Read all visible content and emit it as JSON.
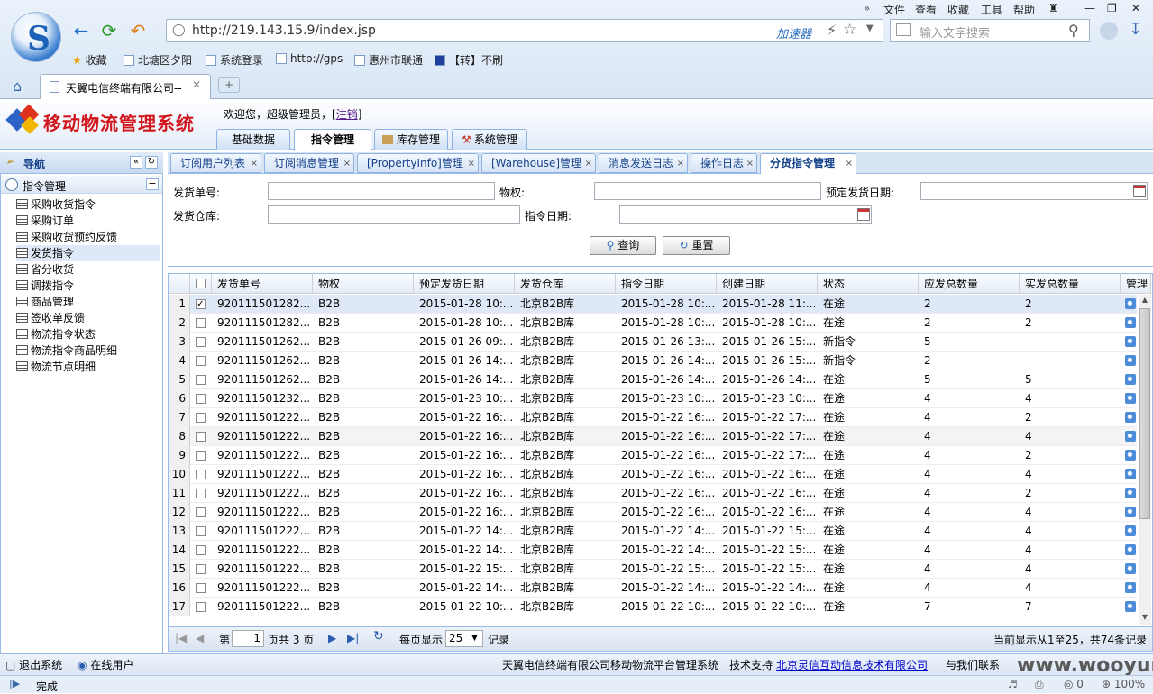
{
  "browser": {
    "menu": [
      "文件",
      "查看",
      "收藏",
      "工具",
      "帮助"
    ],
    "url": "http://219.143.15.9/index.jsp",
    "accelerator": "加速器",
    "search_placeholder": "输入文字搜索",
    "bookmarks": [
      "收藏",
      "北塘区夕阳",
      "系统登录",
      "http://gps",
      "惠州市联通",
      "【转】不刷"
    ],
    "tab_title": "天翼电信终端有限公司--",
    "status": "完成",
    "zoom": "100%",
    "watermark": "www.wooyun.org"
  },
  "app": {
    "title": "移动物流管理系统",
    "welcome": "欢迎您，超级管理员，[",
    "logout": "注销",
    "welcome_end": "]",
    "main_tabs": [
      "基础数据",
      "指令管理",
      "库存管理",
      "系统管理"
    ]
  },
  "nav": {
    "title": "导航",
    "group": "指令管理",
    "items": [
      "采购收货指令",
      "采购订单",
      "采购收货预约反馈",
      "发货指令",
      "省分收货",
      "调拨指令",
      "商品管理",
      "签收单反馈",
      "物流指令状态",
      "物流指令商品明细",
      "物流节点明细"
    ]
  },
  "content_tabs": [
    "订阅用户列表",
    "订阅消息管理",
    "[PropertyInfo]管理",
    "[Warehouse]管理",
    "消息发送日志",
    "操作日志",
    "分货指令管理"
  ],
  "form": {
    "order_no": "发货单号:",
    "property": "物权:",
    "plan_date": "预定发货日期:",
    "warehouse": "发货仓库:",
    "cmd_date": "指令日期:",
    "query": "查询",
    "reset": "重置"
  },
  "grid": {
    "columns": [
      "发货单号",
      "物权",
      "预定发货日期",
      "发货仓库",
      "指令日期",
      "创建日期",
      "状态",
      "应发总数量",
      "实发总数量",
      "管理"
    ],
    "rows": [
      [
        "1",
        "920111501282...",
        "B2B",
        "2015-01-28 10:...",
        "北京B2B库",
        "2015-01-28 10:...",
        "2015-01-28 11:...",
        "在途",
        "2",
        "2"
      ],
      [
        "2",
        "920111501282...",
        "B2B",
        "2015-01-28 10:...",
        "北京B2B库",
        "2015-01-28 10:...",
        "2015-01-28 10:...",
        "在途",
        "2",
        "2"
      ],
      [
        "3",
        "920111501262...",
        "B2B",
        "2015-01-26 09:...",
        "北京B2B库",
        "2015-01-26 13:...",
        "2015-01-26 15:...",
        "新指令",
        "5",
        ""
      ],
      [
        "4",
        "920111501262...",
        "B2B",
        "2015-01-26 14:...",
        "北京B2B库",
        "2015-01-26 14:...",
        "2015-01-26 15:...",
        "新指令",
        "2",
        ""
      ],
      [
        "5",
        "920111501262...",
        "B2B",
        "2015-01-26 14:...",
        "北京B2B库",
        "2015-01-26 14:...",
        "2015-01-26 14:...",
        "在途",
        "5",
        "5"
      ],
      [
        "6",
        "920111501232...",
        "B2B",
        "2015-01-23 10:...",
        "北京B2B库",
        "2015-01-23 10:...",
        "2015-01-23 10:...",
        "在途",
        "4",
        "4"
      ],
      [
        "7",
        "920111501222...",
        "B2B",
        "2015-01-22 16:...",
        "北京B2B库",
        "2015-01-22 16:...",
        "2015-01-22 17:...",
        "在途",
        "4",
        "2"
      ],
      [
        "8",
        "920111501222...",
        "B2B",
        "2015-01-22 16:...",
        "北京B2B库",
        "2015-01-22 16:...",
        "2015-01-22 17:...",
        "在途",
        "4",
        "4"
      ],
      [
        "9",
        "920111501222...",
        "B2B",
        "2015-01-22 16:...",
        "北京B2B库",
        "2015-01-22 16:...",
        "2015-01-22 17:...",
        "在途",
        "4",
        "2"
      ],
      [
        "10",
        "920111501222...",
        "B2B",
        "2015-01-22 16:...",
        "北京B2B库",
        "2015-01-22 16:...",
        "2015-01-22 16:...",
        "在途",
        "4",
        "4"
      ],
      [
        "11",
        "920111501222...",
        "B2B",
        "2015-01-22 16:...",
        "北京B2B库",
        "2015-01-22 16:...",
        "2015-01-22 16:...",
        "在途",
        "4",
        "2"
      ],
      [
        "12",
        "920111501222...",
        "B2B",
        "2015-01-22 16:...",
        "北京B2B库",
        "2015-01-22 16:...",
        "2015-01-22 16:...",
        "在途",
        "4",
        "4"
      ],
      [
        "13",
        "920111501222...",
        "B2B",
        "2015-01-22 14:...",
        "北京B2B库",
        "2015-01-22 14:...",
        "2015-01-22 15:...",
        "在途",
        "4",
        "4"
      ],
      [
        "14",
        "920111501222...",
        "B2B",
        "2015-01-22 14:...",
        "北京B2B库",
        "2015-01-22 14:...",
        "2015-01-22 15:...",
        "在途",
        "4",
        "4"
      ],
      [
        "15",
        "920111501222...",
        "B2B",
        "2015-01-22 15:...",
        "北京B2B库",
        "2015-01-22 15:...",
        "2015-01-22 15:...",
        "在途",
        "4",
        "4"
      ],
      [
        "16",
        "920111501222...",
        "B2B",
        "2015-01-22 14:...",
        "北京B2B库",
        "2015-01-22 14:...",
        "2015-01-22 14:...",
        "在途",
        "4",
        "4"
      ],
      [
        "17",
        "920111501222...",
        "B2B",
        "2015-01-22 10:...",
        "北京B2B库",
        "2015-01-22 10:...",
        "2015-01-22 10:...",
        "在途",
        "7",
        "7"
      ]
    ],
    "checked_row": 0,
    "selected_row": 0,
    "hover_row": 7
  },
  "pager": {
    "page_label": "第",
    "page": "1",
    "of_pages": "页共 3 页",
    "per_page_label": "每页显示",
    "per_page": "25",
    "records_label": "记录",
    "summary": "当前显示从1至25，共74条记录"
  },
  "footer": {
    "logout": "退出系统",
    "online": "在线用户",
    "company": "天翼电信终端有限公司移动物流平台管理系统",
    "support_label": "技术支持",
    "support": "北京灵信互动信息技术有限公司",
    "contact": "与我们联系"
  }
}
